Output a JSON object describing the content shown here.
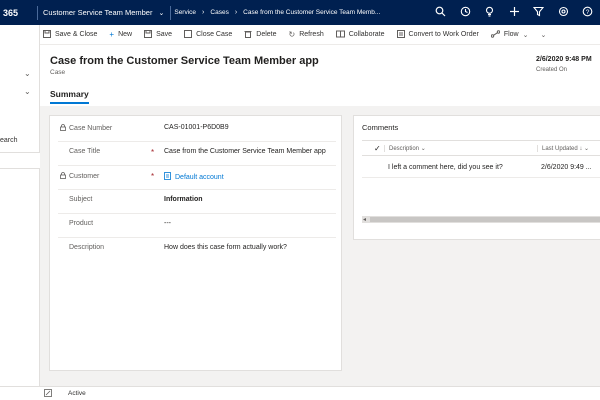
{
  "topbar": {
    "brand": "365",
    "app_name": "Customer Service Team Member",
    "breadcrumb": [
      "Service",
      "Cases",
      "Case from the Customer Service Team Memb..."
    ],
    "icons": [
      "search-icon",
      "recent-icon",
      "lightbulb-icon",
      "plus-icon",
      "filter-icon",
      "settings-icon",
      "help-icon"
    ]
  },
  "leftnav": {
    "search_label": "earch"
  },
  "command_bar": {
    "items": [
      {
        "label": "Save & Close",
        "icon": "save-close-icon"
      },
      {
        "label": "New",
        "icon": "plus-icon"
      },
      {
        "label": "Save",
        "icon": "save-icon"
      },
      {
        "label": "Close Case",
        "icon": "close-case-icon"
      },
      {
        "label": "Delete",
        "icon": "trash-icon"
      },
      {
        "label": "Refresh",
        "icon": "refresh-icon"
      },
      {
        "label": "Collaborate",
        "icon": "collaborate-icon"
      },
      {
        "label": "Convert to Work Order",
        "icon": "work-order-icon"
      },
      {
        "label": "Flow",
        "icon": "flow-icon"
      }
    ]
  },
  "header": {
    "title": "Case from the Customer Service Team Member app",
    "entity": "Case",
    "created_on_value": "2/6/2020 9:48 PM",
    "created_on_label": "Created On"
  },
  "tabs": {
    "summary": "Summary"
  },
  "form": {
    "fields": [
      {
        "label": "Case Number",
        "value": "CAS-01001-P6D0B9",
        "locked": true,
        "required": false
      },
      {
        "label": "Case Title",
        "value": "Case from the Customer Service Team Member app",
        "locked": false,
        "required": true
      },
      {
        "label": "Customer",
        "value": "Default account",
        "locked": true,
        "required": true
      },
      {
        "label": "Subject",
        "value": "Information",
        "locked": false,
        "required": false
      },
      {
        "label": "Product",
        "value": "---",
        "locked": false,
        "required": false
      },
      {
        "label": "Description",
        "value": "How does this case form actually work?",
        "locked": false,
        "required": false
      }
    ],
    "required_mark": "*"
  },
  "comments": {
    "title": "Comments",
    "columns": [
      "Description",
      "Last Updated"
    ],
    "rows": [
      {
        "description": "I left a comment here, did you see it?",
        "last_updated": "2/6/2020 9:49 ..."
      }
    ]
  },
  "status_bar": {
    "status": "Active"
  },
  "colors": {
    "nav_bg": "#002050",
    "accent": "#0078d4",
    "required": "#a4262c"
  }
}
